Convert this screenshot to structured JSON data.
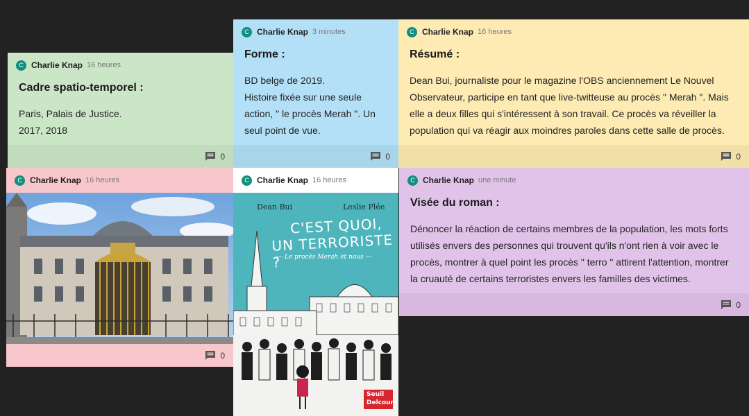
{
  "colors": {
    "board_background": "#222222",
    "avatar": "#0f8f7e",
    "green": "#cbe6c6",
    "blue": "#b3e0f7",
    "yellow": "#fdebb3",
    "pink": "#f8c7cb",
    "white": "#ffffff",
    "purple": "#e1c3e9"
  },
  "cards": [
    {
      "author": "Charlie Knap",
      "avatar_letter": "C",
      "time": "16 heures",
      "title": "Cadre spatio-temporel :",
      "text": "Paris, Palais de Justice.\n2017, 2018",
      "comments": "0"
    },
    {
      "author": "Charlie Knap",
      "avatar_letter": "C",
      "time": "3 minutes",
      "title": "Forme :",
      "text": "BD belge de 2019.\nHistoire fixée sur une seule action, \" le procès Merah \". Un seul point de vue.",
      "comments": "0"
    },
    {
      "author": "Charlie Knap",
      "avatar_letter": "C",
      "time": "16 heures",
      "title": "Résumé :",
      "text": "Dean Bui, journaliste pour le magazine l'OBS anciennement Le Nouvel Observateur, participe en tant que live-twitteuse au procès \" Merah \". Mais elle a deux filles qui s'intéressent à son travail. Ce procès va réveiller la population qui va réagir aux moindres paroles dans cette salle de procès.",
      "comments": "0"
    },
    {
      "author": "Charlie Knap",
      "avatar_letter": "C",
      "time": "16 heures",
      "comments": "0"
    },
    {
      "author": "Charlie Knap",
      "avatar_letter": "C",
      "time": "16 heures",
      "cover": {
        "author_left": "Dean Bui",
        "author_right": "Leslie Plée",
        "title_line1": "C'EST QUOI,",
        "title_line2": "UN TERRORISTE ?",
        "subtitle": "— Le procès Merah et nous —",
        "publisher_line1": "Seuil",
        "publisher_line2": "Delcourt"
      }
    },
    {
      "author": "Charlie Knap",
      "avatar_letter": "C",
      "time": "une minute",
      "title": "Visée du roman :",
      "text": "Dénoncer la réaction de certains membres de la population, les mots forts utilisés envers des personnes qui trouvent qu'ils n'ont rien à voir avec le procès, montrer à quel point les procès \" terro \" attirent l'attention, montrer la cruauté de certains terroristes envers les familles des victimes.",
      "comments": "0"
    }
  ]
}
